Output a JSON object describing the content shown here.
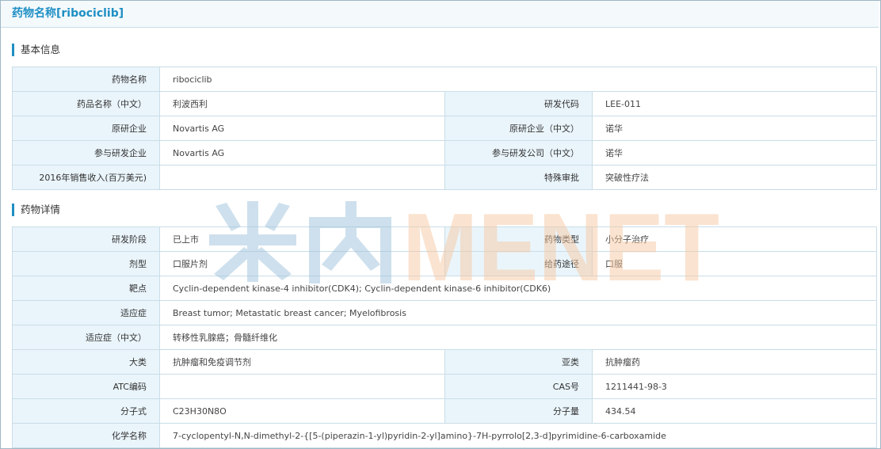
{
  "page_title": "药物名称[ribociclib]",
  "sections": {
    "basic": {
      "title": "基本信息",
      "drug_name_label": "药物名称",
      "drug_name_value": "ribociclib",
      "drug_name_cn_label": "药品名称（中文）",
      "drug_name_cn_value": "利波西利",
      "code_label": "研发代码",
      "code_value": "LEE-011",
      "originator_label": "原研企业",
      "originator_value": "Novartis AG",
      "originator_cn_label": "原研企业（中文）",
      "originator_cn_value": "诺华",
      "partner_label": "参与研发企业",
      "partner_value": "Novartis AG",
      "partner_cn_label": "参与研发公司（中文）",
      "partner_cn_value": "诺华",
      "sales_label": "2016年销售收入(百万美元)",
      "sales_value": "",
      "special_label": "特殊审批",
      "special_value": "突破性疗法"
    },
    "detail": {
      "title": "药物详情",
      "stage_label": "研发阶段",
      "stage_value": "已上市",
      "type_label": "药物类型",
      "type_value": "小分子治疗",
      "form_label": "剂型",
      "form_value": "口服片剂",
      "route_label": "给药途径",
      "route_value": "口服",
      "target_label": "靶点",
      "target_value": "Cyclin-dependent kinase-4 inhibitor(CDK4); Cyclin-dependent kinase-6 inhibitor(CDK6)",
      "indication_label": "适应症",
      "indication_value": "Breast tumor; Metastatic breast cancer; Myelofibrosis",
      "indication_cn_label": "适应症（中文）",
      "indication_cn_value": "转移性乳腺癌；骨髓纤维化",
      "class_label": "大类",
      "class_value": "抗肿瘤和免疫调节剂",
      "subclass_label": "亚类",
      "subclass_value": "抗肿瘤药",
      "atc_label": "ATC编码",
      "atc_value": "",
      "cas_label": "CAS号",
      "cas_value": "1211441-98-3",
      "formula_label": "分子式",
      "formula_value": "C23H30N8O",
      "mw_label": "分子量",
      "mw_value": "434.54",
      "chem_label": "化学名称",
      "chem_value": "7-cyclopentyl-N,N-dimethyl-2-{[5-(piperazin-1-yl)pyridin-2-yl]amino}-7H-pyrrolo[2,3-d]pyrimidine-6-carboxamide"
    }
  },
  "watermark": {
    "text": "米内MENET",
    "color_cn": "#9ec3dc",
    "color_en": "#f7c9a2"
  }
}
